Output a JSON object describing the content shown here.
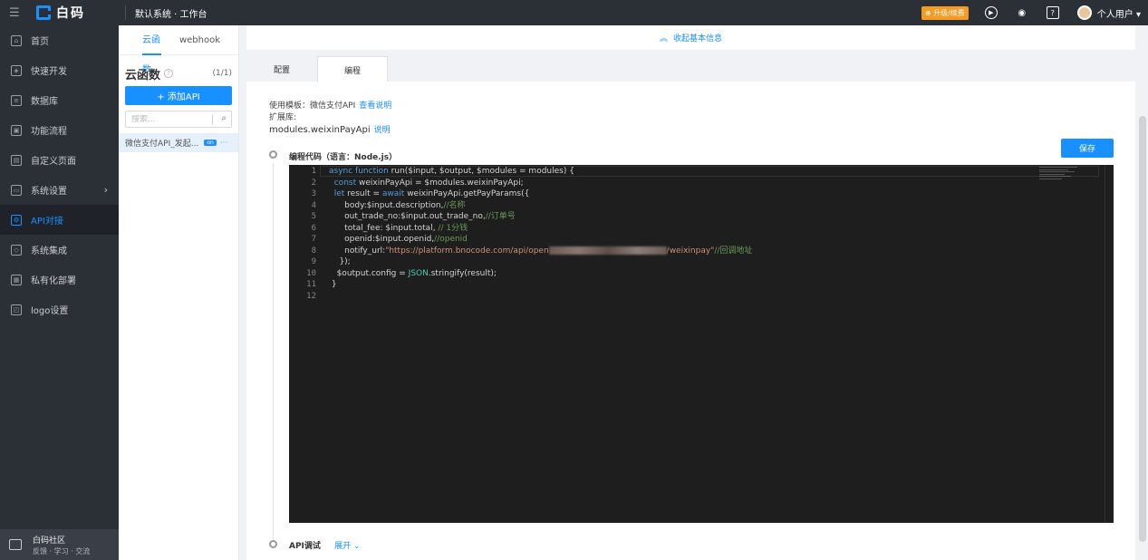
{
  "topbar": {
    "brand": "白码",
    "system_title": "默认系统 · 工作台",
    "upgrade_badge": "升级/续费",
    "user_name": "个人用户"
  },
  "sidebar": {
    "items": [
      {
        "label": "首页",
        "icon": "home-icon"
      },
      {
        "label": "快速开发",
        "icon": "cube-icon"
      },
      {
        "label": "数据库",
        "icon": "database-icon"
      },
      {
        "label": "功能流程",
        "icon": "flow-icon"
      },
      {
        "label": "自定义页面",
        "icon": "page-icon"
      },
      {
        "label": "系统设置",
        "icon": "monitor-icon"
      },
      {
        "label": "API对接",
        "icon": "api-icon"
      },
      {
        "label": "系统集成",
        "icon": "layers-icon"
      },
      {
        "label": "私有化部署",
        "icon": "deploy-icon"
      },
      {
        "label": "logo设置",
        "icon": "logo-icon"
      }
    ],
    "active_index": 6,
    "community": {
      "title": "白码社区",
      "subtitle": "反馈 · 学习 · 交流"
    }
  },
  "function_panel": {
    "tabs": [
      "云函数",
      "webhook"
    ],
    "active_tab": 0,
    "title": "云函数",
    "count": "(1/1)",
    "add_button": "+ 添加API",
    "search_placeholder": "搜索...",
    "items": [
      {
        "label": "微信支付API_发起...",
        "badge": "on"
      }
    ]
  },
  "main": {
    "collapse_label": "收起基本信息",
    "tabs": [
      "配置",
      "编程"
    ],
    "active_tab": 1,
    "template_label": "使用模板：微信支付API",
    "template_link": "查看说明",
    "ext_label": "扩展库:",
    "module_name": "modules.weixinPayApi",
    "module_link": "说明",
    "code_section_label": "编程代码（语言：Node.js）",
    "save_button": "保存",
    "api_debug_label": "API调试",
    "api_debug_toggle": "展开"
  },
  "editor": {
    "line_numbers": [
      "1",
      "2",
      "3",
      "4",
      "5",
      "6",
      "7",
      "8",
      "9",
      "10",
      "11",
      "12"
    ]
  }
}
